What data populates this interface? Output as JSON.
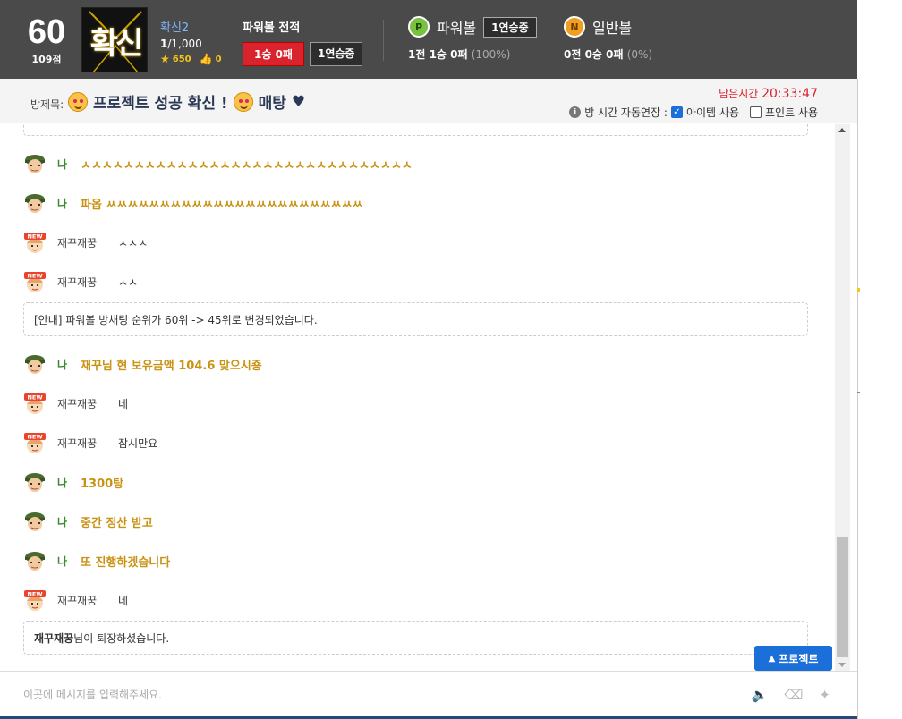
{
  "header": {
    "level": "60",
    "points": "109점",
    "avatar_text": "확신",
    "user_name": "확신2",
    "rank_current": "1",
    "rank_total": "/1,000",
    "stars": "650",
    "likes": "0",
    "record_title": "파워볼 전적",
    "record_wl": "1승 0패",
    "record_streak": "1연승중",
    "powerball": {
      "icon_letter": "P",
      "label": "파워볼",
      "streak": "1연승중",
      "result": "1전 1승 0패",
      "pct": "(100%)"
    },
    "normalball": {
      "icon_letter": "N",
      "label": "일반볼",
      "result": "0전 0승 0패",
      "pct": "(0%)"
    }
  },
  "titlebar": {
    "label": "방제목:",
    "title": "프로젝트 성공 확신 !",
    "title_tail": "매탕",
    "timer_label": "남은시간",
    "timer_value": "20:33:47",
    "auto_extend": "방 시간 자동연장 :",
    "item_use": "아이템 사용",
    "point_use": "포인트 사용"
  },
  "chat": {
    "messages": [
      {
        "who": "me",
        "name": "나",
        "text": "ㅅㅅㅅㅅㅅㅅㅅㅅㅅㅅㅅㅅㅅㅅㅅㅅㅅㅅㅅㅅㅅㅅㅅㅅㅅㅅㅅㅅㅅㅅㅅ"
      },
      {
        "who": "me",
        "name": "나",
        "text": "파옵 ㅆㅆㅆㅆㅆㅆㅆㅆㅆㅆㅆㅆㅆㅆㅆㅆㅆㅆㅆㅆㅆㅆㅆㅆ"
      },
      {
        "who": "other",
        "name": "재꾸재꿍",
        "text": "ㅅㅅㅅ"
      },
      {
        "who": "other",
        "name": "재꾸재꿍",
        "text": "ㅅㅅ"
      },
      {
        "who": "notice",
        "text": "[안내] 파워볼 방채팅 순위가 60위 -> 45위로 변경되었습니다."
      },
      {
        "who": "me",
        "name": "나",
        "text": "재꾸님 현 보유금액 104.6 맞으시죵"
      },
      {
        "who": "other",
        "name": "재꾸재꿍",
        "text": "네"
      },
      {
        "who": "other",
        "name": "재꾸재꿍",
        "text": "잠시만요"
      },
      {
        "who": "me",
        "name": "나",
        "text": "1300탕"
      },
      {
        "who": "me",
        "name": "나",
        "text": "중간 정산 받고"
      },
      {
        "who": "me",
        "name": "나",
        "text": "또 진행하겠습니다"
      },
      {
        "who": "other",
        "name": "재꾸재꿍",
        "text": "네"
      },
      {
        "who": "notice",
        "bold": "재꾸재꿍",
        "text": "님이 퇴장하셨습니다."
      }
    ]
  },
  "project_button": "프로젝트",
  "input": {
    "placeholder": "이곳에 메시지를 입력해주세요."
  },
  "new_badge": "NEW",
  "colors": {
    "header_bg": "#4a4a4a",
    "my_text": "#c99212",
    "my_name": "#3a8a2e",
    "accent_blue": "#1a6fd9",
    "timer_red": "#d9232d"
  }
}
